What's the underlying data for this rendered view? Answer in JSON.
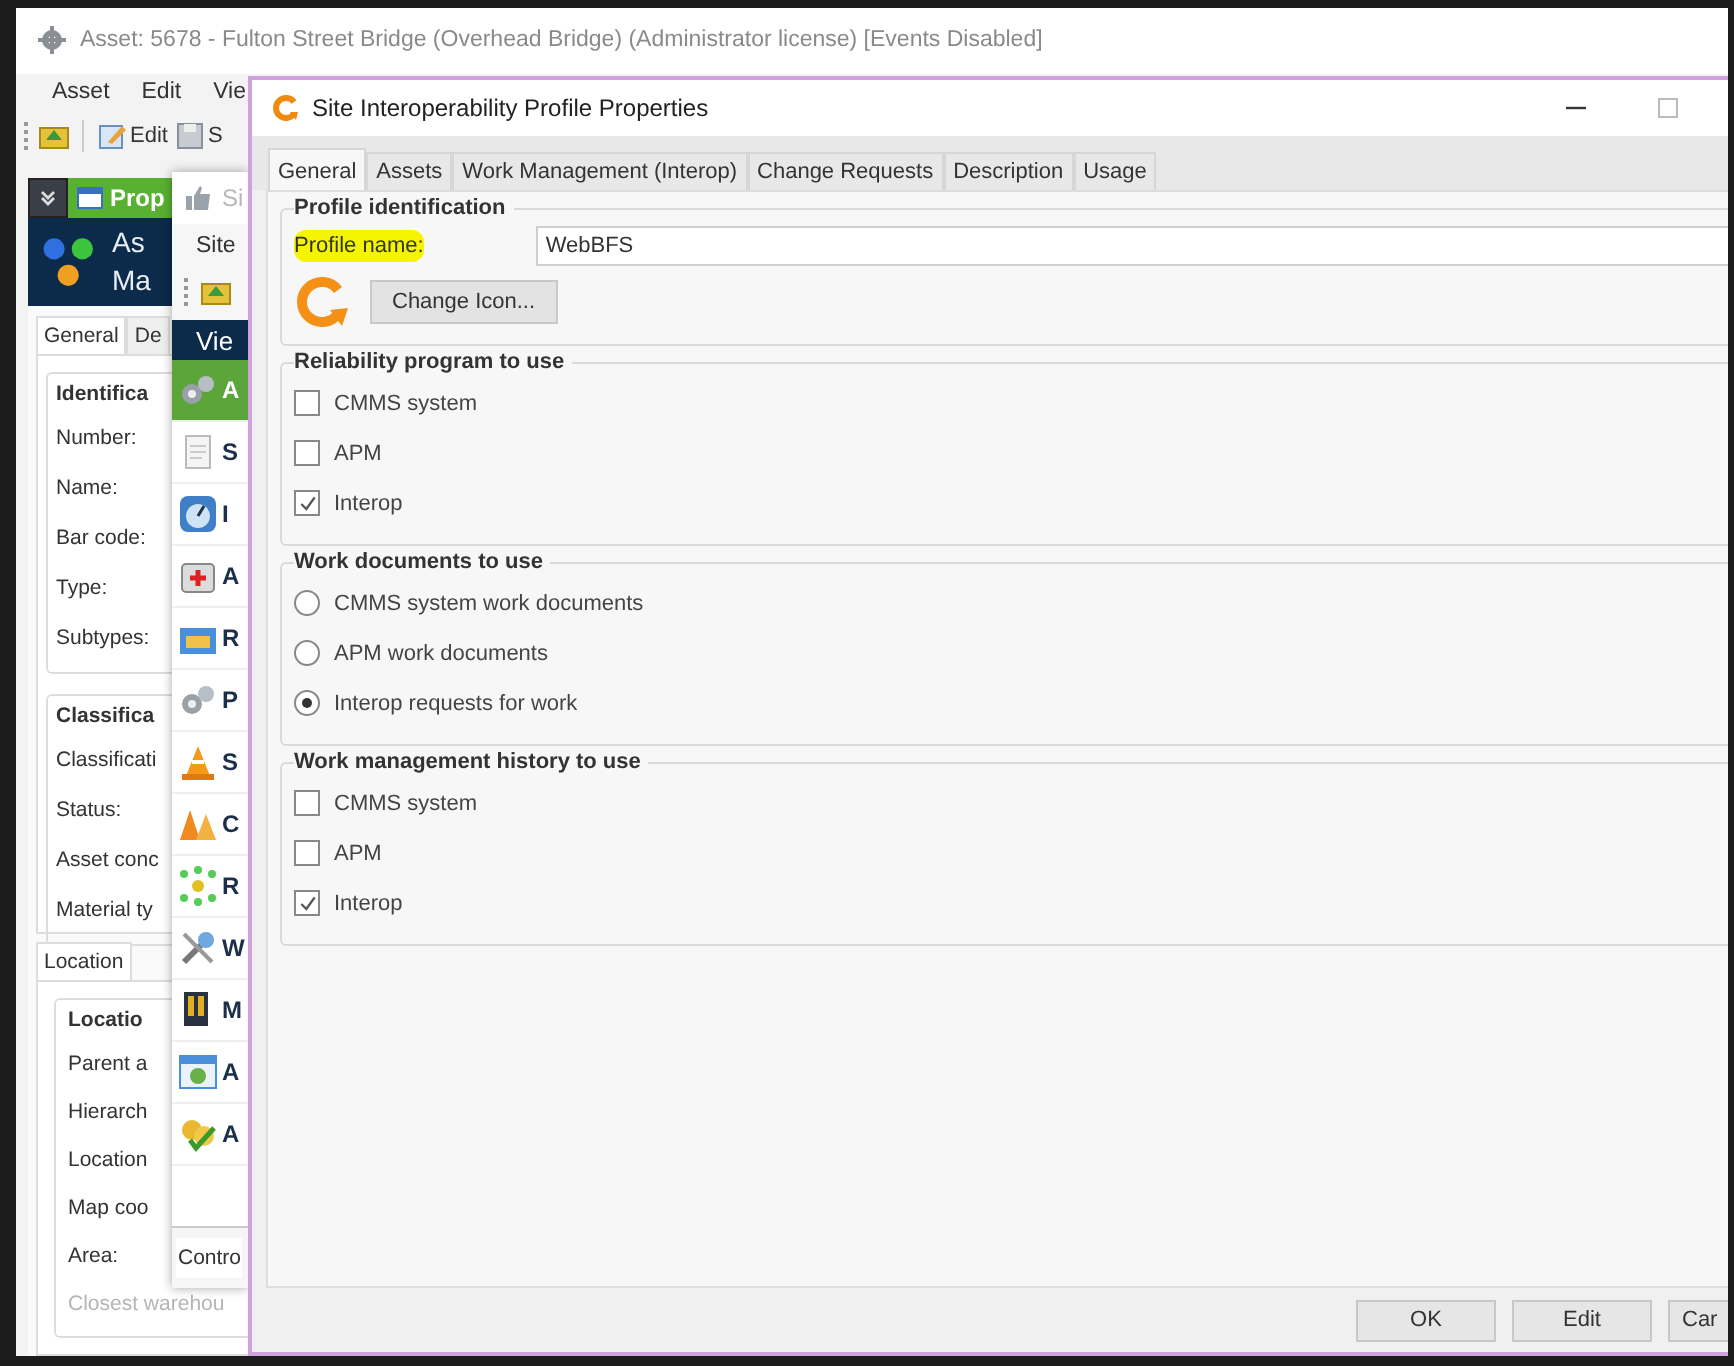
{
  "main_window": {
    "title": "Asset: 5678 - Fulton Street Bridge (Overhead Bridge) (Administrator license) [Events Disabled]",
    "menu": [
      "Asset",
      "Edit",
      "Vie"
    ],
    "toolbar": [
      "Edit",
      "S"
    ],
    "panel_title": "Prop",
    "header_lines": [
      "As",
      "Ma"
    ],
    "tabs": [
      {
        "label": "General",
        "selected": true
      },
      {
        "label": "De",
        "selected": false
      }
    ],
    "groups": [
      {
        "title": "Identifica",
        "fields": [
          "Number:",
          "Name:",
          "Bar code:",
          "Type:",
          "Subtypes:"
        ]
      },
      {
        "title": "Classifica",
        "fields": [
          "Classificati",
          "Status:",
          "Asset conc",
          "Material ty"
        ]
      }
    ],
    "location_tab": {
      "label": "Location",
      "selected": true
    },
    "location_group": {
      "title": "Locatio",
      "fields": [
        {
          "label": "Parent a",
          "disabled": false
        },
        {
          "label": "Hierarch",
          "disabled": false
        },
        {
          "label": "Location",
          "disabled": false
        },
        {
          "label": "Map coo",
          "disabled": false
        },
        {
          "label": "Area:",
          "disabled": false
        },
        {
          "label": "Closest warehou",
          "disabled": true
        }
      ]
    }
  },
  "site_window": {
    "title": "Si",
    "menu": [
      "Site"
    ],
    "header": "Vie",
    "items": [
      {
        "label": "A",
        "selected": true
      },
      {
        "label": "S",
        "selected": false
      },
      {
        "label": "I",
        "selected": false
      },
      {
        "label": "A",
        "selected": false
      },
      {
        "label": "R",
        "selected": false
      },
      {
        "label": "P",
        "selected": false
      },
      {
        "label": "S",
        "selected": false
      },
      {
        "label": "C",
        "selected": false
      },
      {
        "label": "R",
        "selected": false
      },
      {
        "label": "W",
        "selected": false
      },
      {
        "label": "M",
        "selected": false
      },
      {
        "label": "A",
        "selected": false
      },
      {
        "label": "A",
        "selected": false
      }
    ],
    "bottom_tab": "Contro"
  },
  "dialog": {
    "title": "Site Interoperability Profile Properties",
    "tabs": [
      {
        "label": "General",
        "selected": true
      },
      {
        "label": "Assets",
        "selected": false
      },
      {
        "label": "Work Management (Interop)",
        "selected": false
      },
      {
        "label": "Change Requests",
        "selected": false
      },
      {
        "label": "Description",
        "selected": false
      },
      {
        "label": "Usage",
        "selected": false
      }
    ],
    "profile_identification": {
      "title": "Profile identification",
      "name_label": "Profile name:",
      "name_highlighted": true,
      "name_value": "WebBFS",
      "change_icon_button": "Change Icon..."
    },
    "option_groups": [
      {
        "title": "Reliability program to use",
        "options": [
          {
            "kind": "checkbox",
            "label": "CMMS system",
            "checked": false
          },
          {
            "kind": "checkbox",
            "label": "APM",
            "checked": false
          },
          {
            "kind": "checkbox",
            "label": "Interop",
            "checked": true
          }
        ]
      },
      {
        "title": "Work documents to use",
        "options": [
          {
            "kind": "radio",
            "label": "CMMS system work documents",
            "selected": false
          },
          {
            "kind": "radio",
            "label": "APM work documents",
            "selected": false
          },
          {
            "kind": "radio",
            "label": "Interop requests for work",
            "selected": true
          }
        ]
      },
      {
        "title": "Work management history to use",
        "options": [
          {
            "kind": "checkbox",
            "label": "CMMS system",
            "checked": false
          },
          {
            "kind": "checkbox",
            "label": "APM",
            "checked": false
          },
          {
            "kind": "checkbox",
            "label": "Interop",
            "checked": true
          }
        ]
      }
    ],
    "buttons": [
      "OK",
      "Edit",
      "Car"
    ]
  }
}
